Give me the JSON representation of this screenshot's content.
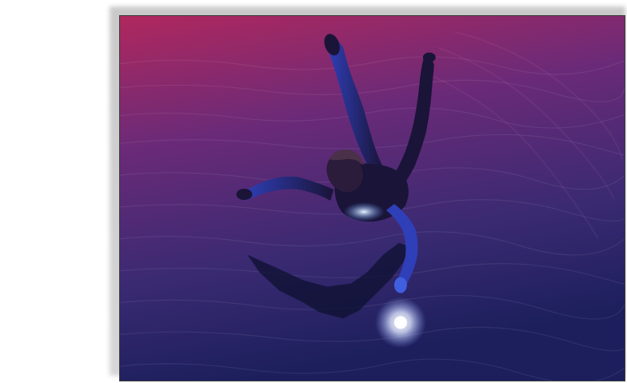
{
  "image": {
    "subject": "figure-floating-on-water",
    "palette": {
      "water_top": "#b0285e",
      "water_mid": "#4a2a7a",
      "water_bottom": "#1c1f5c",
      "figure": "#1a1438",
      "figure_highlight": "#3f5fe0",
      "glow": "#eaf2ff",
      "shadow": "#0d1030"
    }
  }
}
